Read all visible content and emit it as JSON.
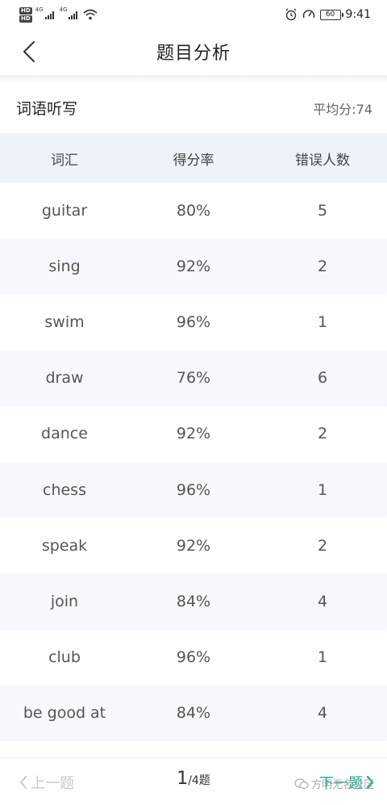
{
  "status_bar": {
    "hd1": "HD",
    "hd2": "HD",
    "net1": "4G",
    "net2": "4G",
    "battery": "60",
    "time": "9:41"
  },
  "nav": {
    "title": "题目分析"
  },
  "section": {
    "title": "词语听写",
    "average": "平均分:74"
  },
  "table": {
    "headers": [
      "词汇",
      "得分率",
      "错误人数"
    ],
    "rows": [
      {
        "word": "guitar",
        "rate": "80%",
        "errors": "5"
      },
      {
        "word": "sing",
        "rate": "92%",
        "errors": "2"
      },
      {
        "word": "swim",
        "rate": "96%",
        "errors": "1"
      },
      {
        "word": "draw",
        "rate": "76%",
        "errors": "6"
      },
      {
        "word": "dance",
        "rate": "92%",
        "errors": "2"
      },
      {
        "word": "chess",
        "rate": "96%",
        "errors": "1"
      },
      {
        "word": "speak",
        "rate": "92%",
        "errors": "2"
      },
      {
        "word": "join",
        "rate": "84%",
        "errors": "4"
      },
      {
        "word": "club",
        "rate": "96%",
        "errors": "1"
      },
      {
        "word": "be good at",
        "rate": "84%",
        "errors": "4"
      }
    ]
  },
  "bottom": {
    "prev_label": "上一题",
    "current_page": "1",
    "total_pages": "/4题",
    "next_label": "下一题",
    "watermark": "方明无名校区"
  },
  "colors": {
    "accent": "#1fb28a",
    "header_bg": "#eef3fa",
    "stripe": "#f5f8fd"
  }
}
